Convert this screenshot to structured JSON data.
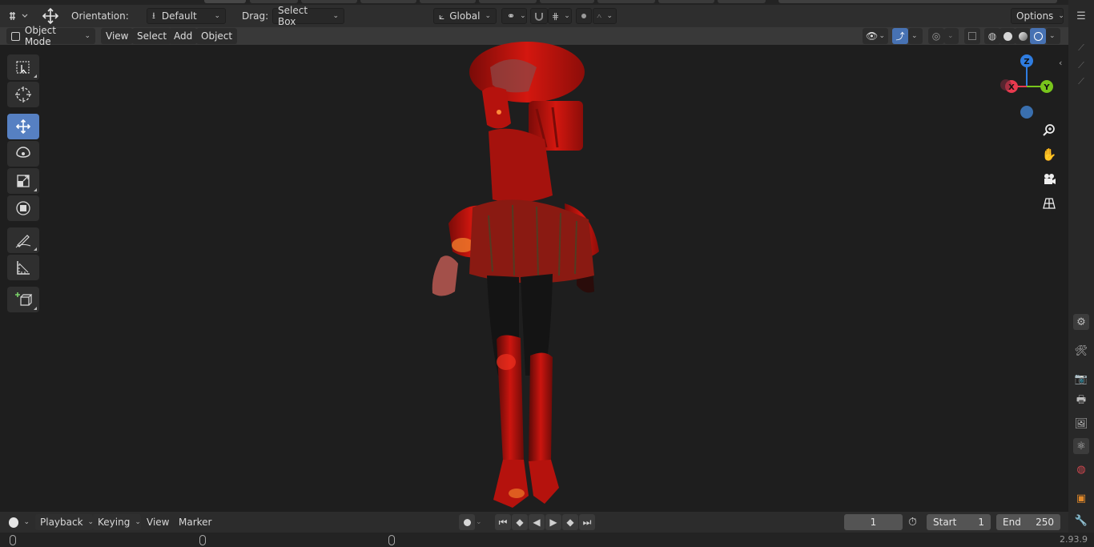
{
  "tool_header": {
    "orientation_label": "Orientation:",
    "orientation_value": "Default",
    "drag_label": "Drag:",
    "drag_value": "Select Box",
    "transform_orientation": "Global",
    "options_label": "Options"
  },
  "viewport_header": {
    "mode": "Object Mode",
    "menus": [
      "View",
      "Select",
      "Add",
      "Object"
    ]
  },
  "gizmo": {
    "z": "Z",
    "x": "X",
    "y": "Y",
    "colors": {
      "x": "#e83a4e",
      "y": "#78c51c",
      "z": "#2f7de1",
      "neg": "#3a6fae"
    }
  },
  "timeline": {
    "playback_label": "Playback",
    "keying_label": "Keying",
    "view_label": "View",
    "marker_label": "Marker",
    "current_frame": "1",
    "start_label": "Start",
    "start_value": "1",
    "end_label": "End",
    "end_value": "250"
  },
  "status": {
    "version": "2.93.9"
  },
  "colors": {
    "accent": "#5680c2",
    "model_red": "#c61510"
  }
}
